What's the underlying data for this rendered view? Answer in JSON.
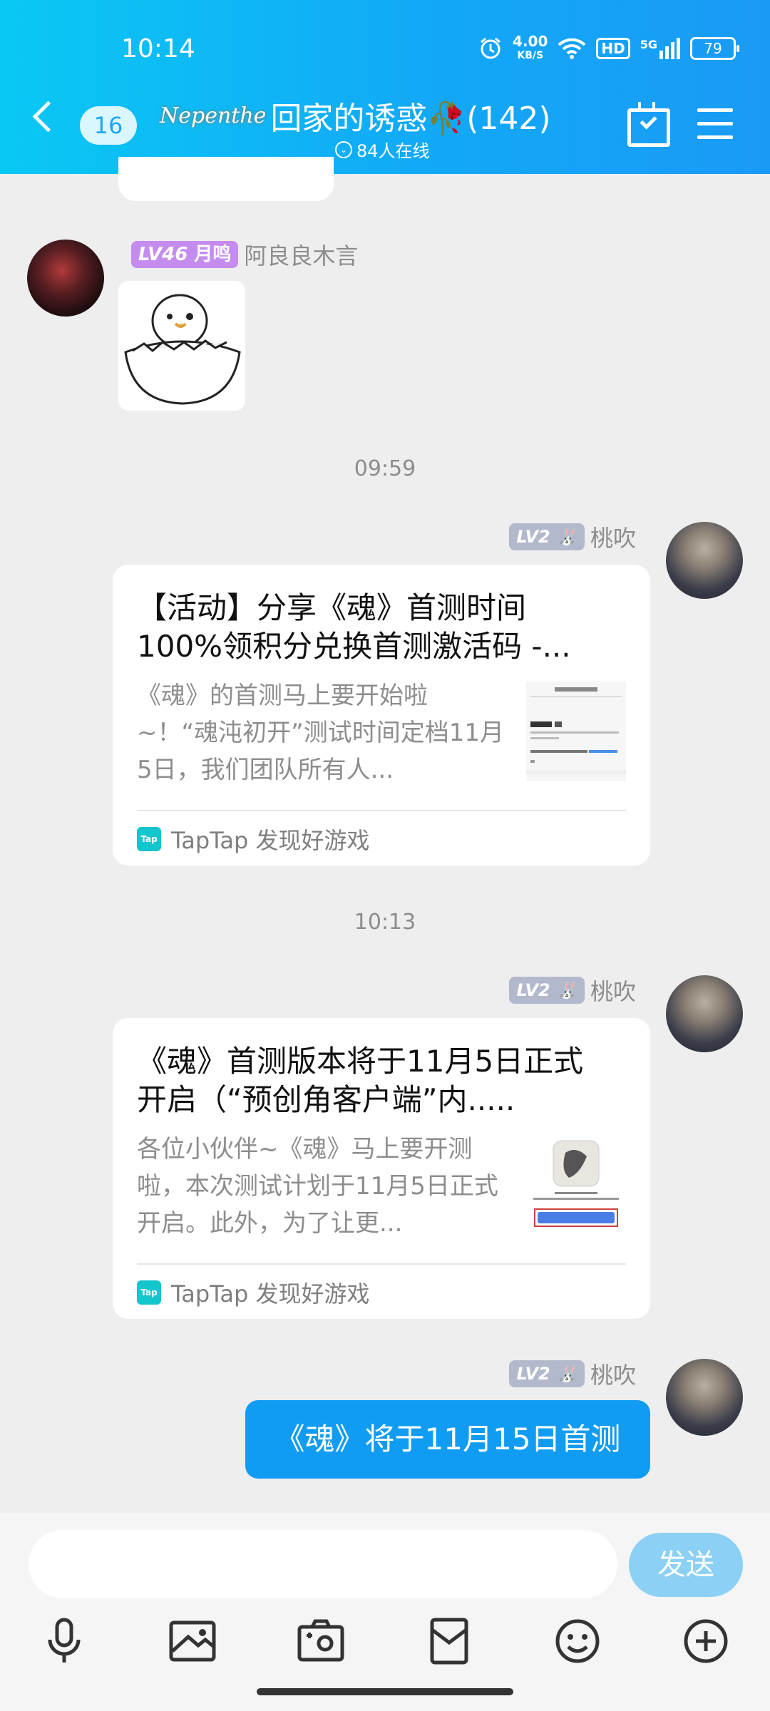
{
  "status_bar": {
    "time": "10:14",
    "network_speed_value": "4.00",
    "network_speed_unit": "KB/S",
    "hd": "HD",
    "signal": "5G",
    "battery": "79"
  },
  "header": {
    "unread_count": "16",
    "group_logo_text": "Nepenthe",
    "group_name": "回家的诱惑🥀(142)",
    "online_status": "84人在线"
  },
  "messages": {
    "msg1": {
      "level": "LV46",
      "title": "月鸣",
      "sender": "阿良良木言"
    },
    "time1": "09:59",
    "msg2": {
      "level": "LV2",
      "sender": "桃吹",
      "card_title": "【活动】分享《魂》首测时间100%领积分兑换首测激活码 -...",
      "card_desc": "《魂》的首测马上要开始啦~！“魂沌初开”测试时间定档11月5日，我们团队所有人...",
      "source": "TapTap 发现好游戏",
      "tap_label": "Tap"
    },
    "time2": "10:13",
    "msg3": {
      "level": "LV2",
      "sender": "桃吹",
      "card_title": "《魂》首测版本将于11月5日正式开启（“预创角客户端”内.....",
      "card_desc": "各位小伙伴~《魂》马上要开测啦，本次测试计划于11月5日正式开启。此外，为了让更...",
      "source": "TapTap 发现好游戏",
      "tap_label": "Tap"
    },
    "msg4": {
      "level": "LV2",
      "sender": "桃吹",
      "text": "《魂》将于11月15日首测"
    }
  },
  "input": {
    "send_label": "发送"
  },
  "colors": {
    "header_gradient_start": "#0ac8f4",
    "header_gradient_end": "#1a9af5",
    "my_bubble": "#119cf3",
    "send_button": "#8cd0f5",
    "level46_badge": "#c58cf0",
    "level2_badge": "#b3b9cc"
  },
  "icons": {
    "toolbar": [
      "microphone-icon",
      "image-icon",
      "camera-icon",
      "red-packet-icon",
      "emoji-icon",
      "plus-icon"
    ]
  }
}
